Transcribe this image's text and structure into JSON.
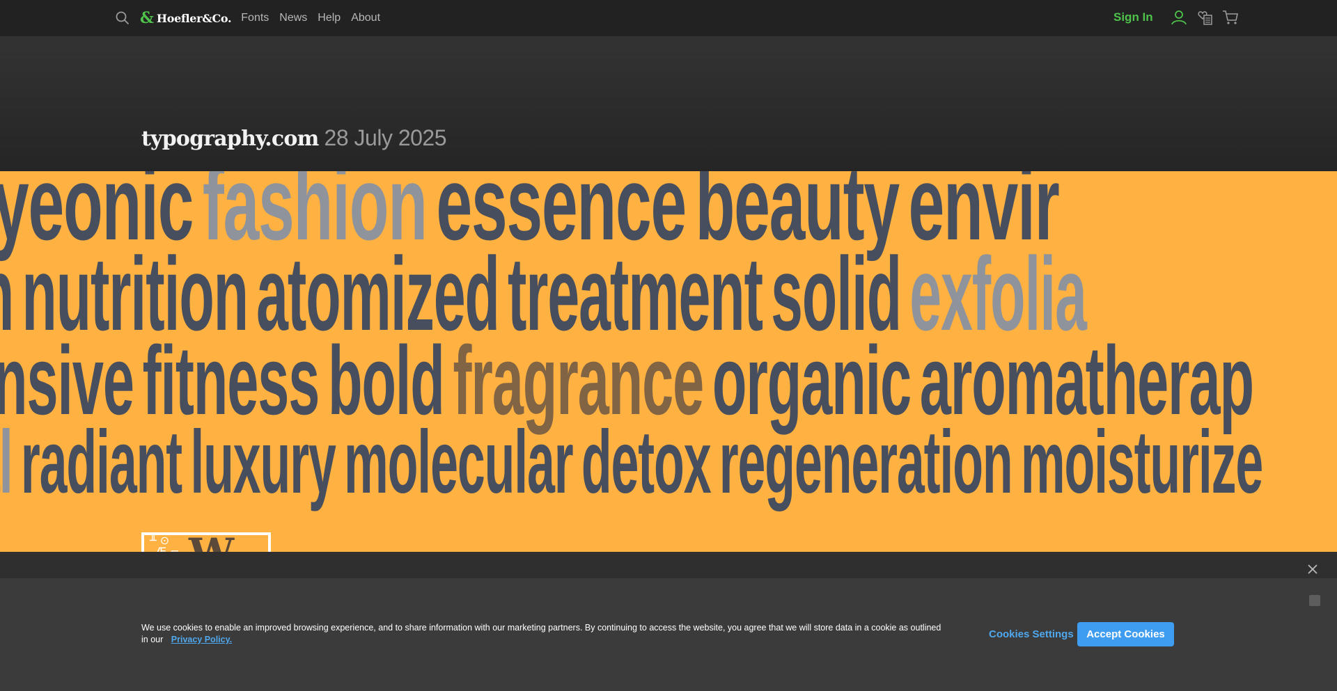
{
  "nav": {
    "brand_amp": "&",
    "brand": "Hoefler&Co.",
    "links": [
      "Fonts",
      "News",
      "Help",
      "About"
    ],
    "sign_in": "Sign In"
  },
  "header": {
    "site": "typography.com",
    "date": "28 July 2025"
  },
  "banner": {
    "background": "#ffb241",
    "word_color": "#474e5d",
    "lines": [
      {
        "words": [
          {
            "t": "yeonic",
            "c": "dark"
          },
          {
            "t": "fashion",
            "c": "gray"
          },
          {
            "t": "essence",
            "c": "dark"
          },
          {
            "t": "beauty",
            "c": "dark"
          },
          {
            "t": "envir",
            "c": "dark"
          }
        ]
      },
      {
        "words": [
          {
            "t": "n",
            "c": "dark"
          },
          {
            "t": "nutrition",
            "c": "dark"
          },
          {
            "t": "atomized",
            "c": "dark"
          },
          {
            "t": "treatment",
            "c": "dark"
          },
          {
            "t": "solid",
            "c": "dark"
          },
          {
            "t": "exfolia",
            "c": "gray"
          }
        ]
      },
      {
        "words": [
          {
            "t": "nsive",
            "c": "dark"
          },
          {
            "t": "fitness",
            "c": "dark"
          },
          {
            "t": "bold",
            "c": "dark"
          },
          {
            "t": "fragrance",
            "c": "brown"
          },
          {
            "t": "organic",
            "c": "dark"
          },
          {
            "t": "aromatherap",
            "c": "dark"
          }
        ]
      },
      {
        "words": [
          {
            "t": "al",
            "c": "gray"
          },
          {
            "t": "radiant",
            "c": "dark"
          },
          {
            "t": "luxury",
            "c": "dark"
          },
          {
            "t": "molecular",
            "c": "dark"
          },
          {
            "t": "detox",
            "c": "dark"
          },
          {
            "t": "regeneration",
            "c": "dark"
          },
          {
            "t": "moisturize",
            "c": "dark"
          }
        ]
      }
    ]
  },
  "cookie": {
    "text": "We use cookies to enable an improved browsing experience, and to share information with our marketing partners. By continuing to access the website, you agree that we will store data in a cookie as outlined in our",
    "privacy": "Privacy Policy.",
    "settings": "Cookies Settings",
    "accept": "Accept Cookies"
  }
}
